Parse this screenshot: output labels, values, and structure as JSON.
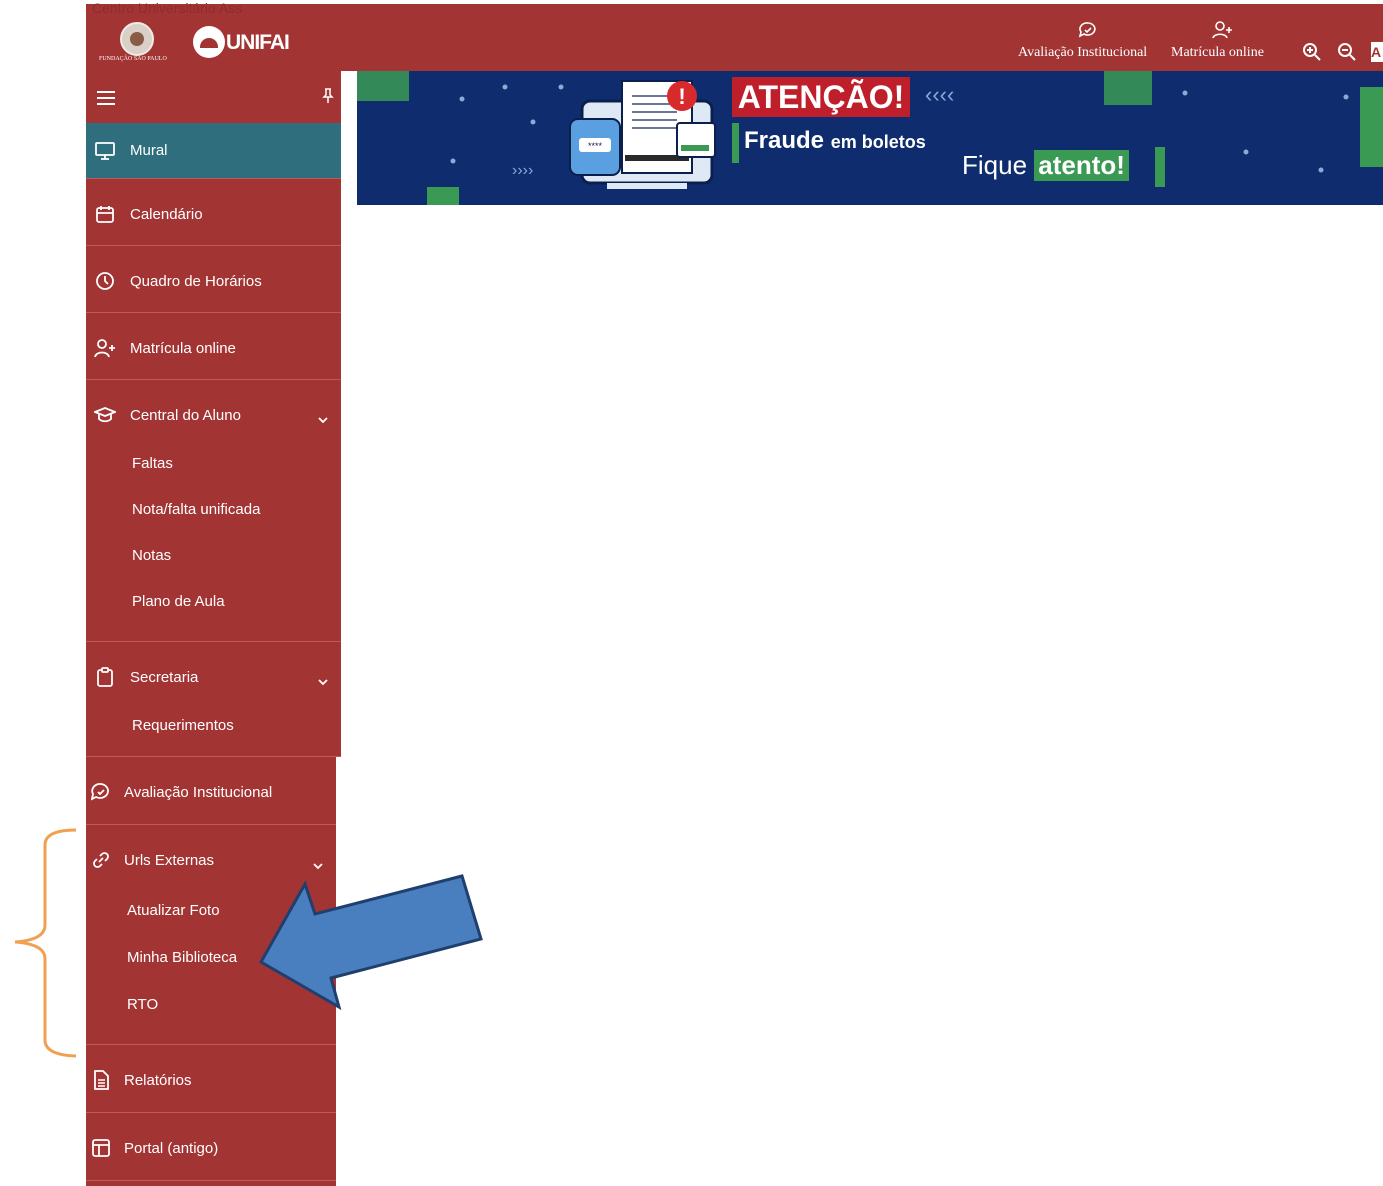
{
  "header": {
    "watermark_text": "Centro Universitário Ass",
    "fsp_caption": "FUNDAÇÃO SÃO PAULO",
    "brand": "UNIFAI",
    "links": [
      {
        "label": "Avaliação Institucional",
        "icon": "chat-check-icon"
      },
      {
        "label": "Matrícula online",
        "icon": "user-plus-icon"
      }
    ],
    "zoom_in_icon": "zoom-in-icon",
    "zoom_out_icon": "zoom-out-icon",
    "font_button_label": "A"
  },
  "sidebar": {
    "items": [
      {
        "label": "Mural",
        "icon": "monitor-icon",
        "active": true
      },
      {
        "label": "Calendário",
        "icon": "calendar-icon"
      },
      {
        "label": "Quadro de Horários",
        "icon": "clock-icon"
      },
      {
        "label": "Matrícula online",
        "icon": "user-plus-icon"
      },
      {
        "label": "Central do Aluno",
        "icon": "graduation-cap-icon",
        "expanded": true,
        "children": [
          "Faltas",
          "Nota/falta unificada",
          "Notas",
          "Plano de Aula"
        ]
      },
      {
        "label": "Secretaria",
        "icon": "clipboard-icon",
        "expanded": true,
        "children": [
          "Requerimentos"
        ]
      },
      {
        "label": "Avaliação Institucional",
        "icon": "chat-check-icon"
      },
      {
        "label": "Urls Externas",
        "icon": "link-icon",
        "expanded": true,
        "children": [
          "Atualizar Foto",
          "Minha Biblioteca",
          "RTO"
        ]
      },
      {
        "label": "Relatórios",
        "icon": "document-icon"
      },
      {
        "label": "Portal (antigo)",
        "icon": "layout-icon"
      }
    ]
  },
  "banner": {
    "alert_title": "ATENÇÃO!",
    "line1_bold": "Fraude",
    "line1_rest": "em boletos",
    "line2_prefix": "Fique",
    "line2_highlight": "atento!",
    "card_mask": "****",
    "colors": {
      "background": "#0f2d6e",
      "alert": "#bf1f2a",
      "green": "#3a9a54"
    }
  },
  "colors": {
    "sidebar": "#a33434",
    "active_item": "#2f6f7d",
    "annotation_arrow": "#4a7fbf",
    "annotation_bracket": "#f0a050"
  }
}
